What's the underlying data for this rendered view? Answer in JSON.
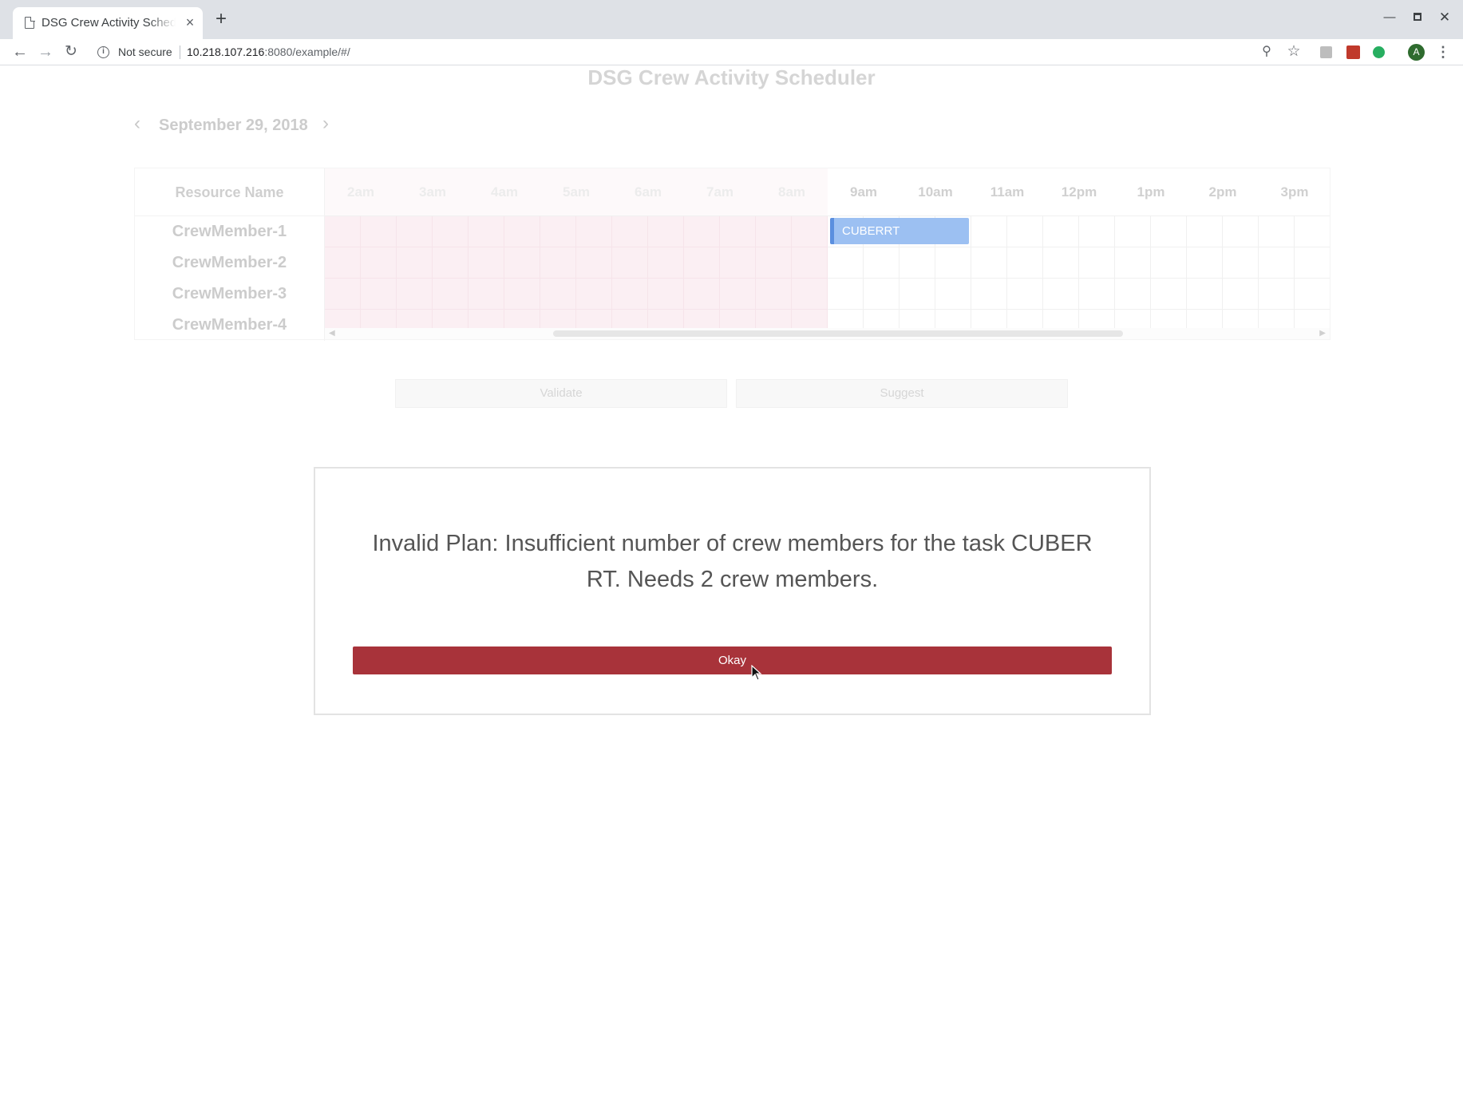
{
  "browser": {
    "tab_title": "DSG Crew Activity Scheduler",
    "tab_close": "×",
    "new_tab": "+",
    "security_label": "Not secure",
    "url_host": "10.218.107.216",
    "url_rest": ":8080/example/#/",
    "profile_initial": "A"
  },
  "app": {
    "title": "DSG Crew Activity Scheduler",
    "date": "September 29, 2018",
    "prev_glyph": "‹",
    "next_glyph": "›"
  },
  "scheduler": {
    "resource_header": "Resource Name",
    "resources": [
      "CrewMember-1",
      "CrewMember-2",
      "CrewMember-3",
      "CrewMember-4"
    ],
    "hours": [
      "2am",
      "3am",
      "4am",
      "5am",
      "6am",
      "7am",
      "8am",
      "9am",
      "10am",
      "11am",
      "12pm",
      "1pm",
      "2pm",
      "3pm"
    ],
    "unavailable_hours": [
      "2am",
      "3am",
      "4am",
      "5am",
      "6am",
      "7am",
      "8am"
    ],
    "events": [
      {
        "label": "CUBERRT",
        "resource": "CrewMember-1",
        "start": "9am",
        "end": "11am",
        "color": "#9cc0f2",
        "accent": "#5b8fdf"
      }
    ]
  },
  "actions": {
    "validate_label": "Validate",
    "suggest_label": "Suggest"
  },
  "dialog": {
    "message": "Invalid Plan: Insufficient number of crew members for the task CUBER RT. Needs 2 crew members.",
    "okay_label": "Okay",
    "okay_color": "#a8333a"
  }
}
